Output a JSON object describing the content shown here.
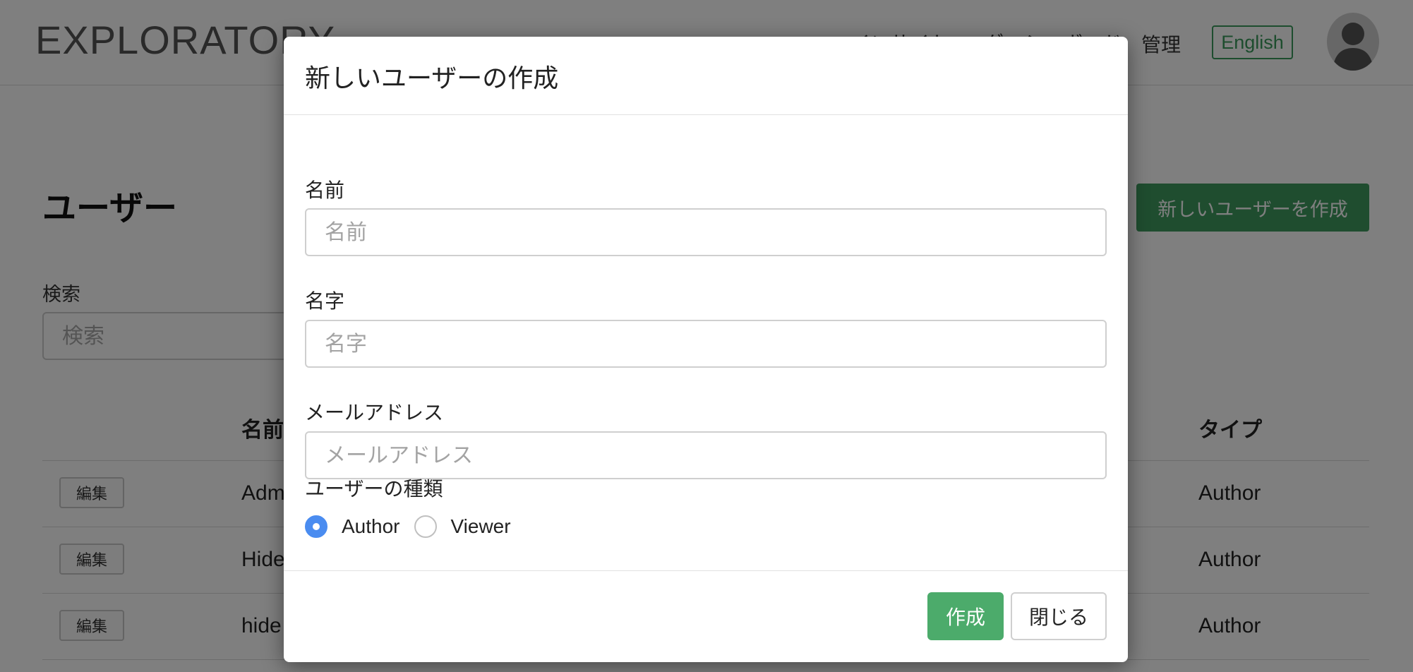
{
  "navbar": {
    "logo": "EXPLORATORY",
    "links": [
      "インサイト",
      "ダッシュボード"
    ],
    "admin": "管理",
    "language_button": "English",
    "avatar_icon": "user-silhouette-icon"
  },
  "page": {
    "title": "ユーザー",
    "create_user_button": "新しいユーザーを作成",
    "search": {
      "label": "検索",
      "placeholder": "検索"
    },
    "table": {
      "headers": {
        "name": "名前",
        "type": "タイプ"
      },
      "rows": [
        {
          "edit": "編集",
          "name": "Adm",
          "type": "Author"
        },
        {
          "edit": "編集",
          "name": "Hide",
          "type": "Author"
        },
        {
          "edit": "編集",
          "name": "hide",
          "type": "Author"
        }
      ]
    }
  },
  "modal": {
    "title": "新しいユーザーの作成",
    "fields": {
      "first_name": {
        "label": "名前",
        "placeholder": "名前",
        "value": ""
      },
      "last_name": {
        "label": "名字",
        "placeholder": "名字",
        "value": ""
      },
      "email": {
        "label": "メールアドレス",
        "placeholder": "メールアドレス",
        "value": ""
      }
    },
    "user_type": {
      "label": "ユーザーの種類",
      "options": [
        {
          "label": "Author",
          "checked": true
        },
        {
          "label": "Viewer",
          "checked": false
        }
      ]
    },
    "buttons": {
      "create": "作成",
      "close": "閉じる"
    }
  },
  "colors": {
    "primary_green": "#3f9a5f",
    "radio_checked": "#4a8cf0",
    "overlay": "rgba(0,0,0,0.5)"
  }
}
